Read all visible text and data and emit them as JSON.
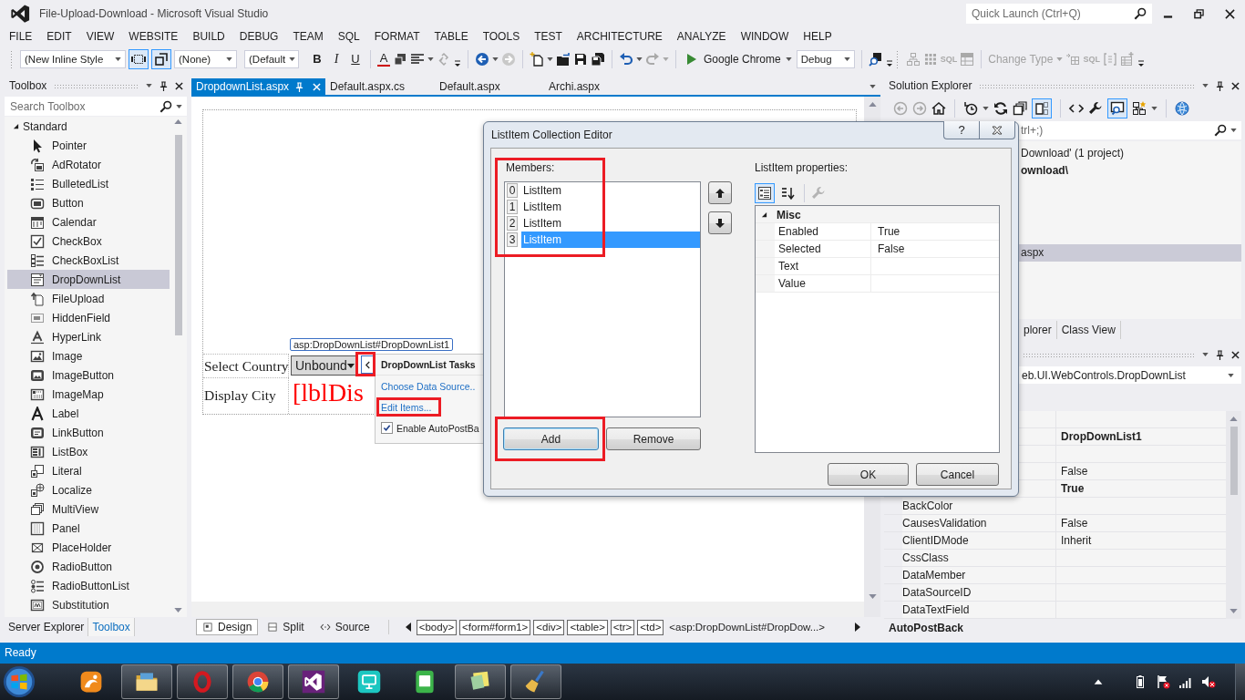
{
  "window": {
    "title": "File-Upload-Download - Microsoft Visual Studio",
    "quick_launch": {
      "placeholder": "Quick Launch (Ctrl+Q)"
    }
  },
  "menu": [
    "FILE",
    "EDIT",
    "VIEW",
    "WEBSITE",
    "BUILD",
    "DEBUG",
    "TEAM",
    "SQL",
    "FORMAT",
    "TABLE",
    "TOOLS",
    "TEST",
    "ARCHITECTURE",
    "ANALYZE",
    "WINDOW",
    "HELP"
  ],
  "toolbar": {
    "style_boxes": [
      "(New Inline Style",
      "(None)",
      "(Default"
    ],
    "layout_toggles": [
      {
        "on": true
      },
      {
        "on": true
      }
    ],
    "format_buttons": [
      {
        "kind": "bold",
        "label": "B"
      },
      {
        "kind": "italic",
        "label": "I"
      },
      {
        "kind": "underline",
        "label": "U"
      },
      {
        "kind": "color",
        "label": "A"
      }
    ],
    "run_button": "Google Chrome",
    "configuration": "Debug",
    "sql_buttons": [
      "SQL",
      "SQL"
    ],
    "change_type": {
      "label": "Change Type",
      "disabled": true
    }
  },
  "toolbox": {
    "title": "Toolbox",
    "search": {
      "placeholder": "Search Toolbox"
    },
    "groups": [
      {
        "label": "Standard",
        "expanded": true,
        "children": [
          {
            "label": "Pointer",
            "selected": false
          },
          {
            "label": "AdRotator",
            "selected": false
          },
          {
            "label": "BulletedList",
            "selected": false
          },
          {
            "label": "Button",
            "selected": false
          },
          {
            "label": "Calendar",
            "selected": false
          },
          {
            "label": "CheckBox",
            "selected": false
          },
          {
            "label": "CheckBoxList",
            "selected": false
          },
          {
            "label": "DropDownList",
            "selected": true
          },
          {
            "label": "FileUpload",
            "selected": false
          },
          {
            "label": "HiddenField",
            "selected": false
          },
          {
            "label": "HyperLink",
            "selected": false
          },
          {
            "label": "Image",
            "selected": false
          },
          {
            "label": "ImageButton",
            "selected": false
          },
          {
            "label": "ImageMap",
            "selected": false
          },
          {
            "label": "Label",
            "selected": false
          },
          {
            "label": "LinkButton",
            "selected": false
          },
          {
            "label": "ListBox",
            "selected": false
          },
          {
            "label": "Literal",
            "selected": false
          },
          {
            "label": "Localize",
            "selected": false
          },
          {
            "label": "MultiView",
            "selected": false
          },
          {
            "label": "Panel",
            "selected": false
          },
          {
            "label": "PlaceHolder",
            "selected": false
          },
          {
            "label": "RadioButton",
            "selected": false
          },
          {
            "label": "RadioButtonList",
            "selected": false
          },
          {
            "label": "Substitution",
            "selected": false
          }
        ]
      }
    ],
    "tabs": [
      {
        "label": "Server Explorer",
        "selected": false
      },
      {
        "label": "Toolbox",
        "selected": true
      }
    ]
  },
  "document_tabs": [
    {
      "label": "DropdownList.aspx",
      "selected": true
    },
    {
      "label": "Default.aspx.cs",
      "selected": false
    },
    {
      "label": "Default.aspx",
      "selected": false
    },
    {
      "label": "Archi.aspx",
      "selected": false
    }
  ],
  "designer": {
    "control_tag": "asp:DropDownList#DropDownList1",
    "rows": [
      {
        "kind": "dropdown",
        "label": "Select Country",
        "value": "Unbound"
      },
      {
        "kind": "label",
        "label": "Display City",
        "value": "[lblDis"
      }
    ],
    "smart_tag": {
      "highlighted": true
    },
    "tasks": {
      "title": "DropDownList Tasks",
      "items": [
        {
          "kind": "link",
          "label": "Choose Data Source..",
          "highlighted": false
        },
        {
          "kind": "link",
          "label": "Edit Items...",
          "highlighted": true
        },
        {
          "kind": "checkbox",
          "label": "Enable AutoPostBa",
          "checked": true
        }
      ]
    },
    "views": [
      {
        "label": "Design",
        "selected": true
      },
      {
        "label": "Split",
        "selected": false
      },
      {
        "label": "Source",
        "selected": false
      }
    ],
    "breadcrumb": [
      {
        "label": "<body>",
        "selected": false
      },
      {
        "label": "<form#form1>",
        "selected": false
      },
      {
        "label": "<div>",
        "selected": false
      },
      {
        "label": "<table>",
        "selected": false
      },
      {
        "label": "<tr>",
        "selected": false
      },
      {
        "label": "<td>",
        "selected": false
      },
      {
        "label": "<asp:DropDownList#DropDow...>",
        "selected": true
      }
    ]
  },
  "dialog": {
    "title": "ListItem Collection Editor",
    "help_button": "?",
    "members": {
      "label": "Members:",
      "highlighted": true,
      "items": [
        {
          "index": "0",
          "label": "ListItem",
          "selected": false
        },
        {
          "index": "1",
          "label": "ListItem",
          "selected": false
        },
        {
          "index": "2",
          "label": "ListItem",
          "selected": false
        },
        {
          "index": "3",
          "label": "ListItem",
          "selected": true
        }
      ]
    },
    "properties": {
      "label": "ListItem properties:",
      "sort_modes": [
        {
          "selected": true
        },
        {
          "selected": false
        }
      ],
      "category": {
        "label": "Misc",
        "expanded": true
      },
      "rows": [
        {
          "name": "Enabled",
          "value": "True"
        },
        {
          "name": "Selected",
          "value": "False"
        },
        {
          "name": "Text"
        },
        {
          "name": "Value"
        }
      ]
    },
    "list_buttons": [
      {
        "label": "Add",
        "highlighted": true,
        "focused": true
      },
      {
        "label": "Remove",
        "highlighted": false,
        "focused": false
      }
    ],
    "buttons": [
      "OK",
      "Cancel"
    ]
  },
  "solution_explorer": {
    "title": "Solution Explorer",
    "toolbar_toggles": [
      {
        "on": true
      },
      {
        "on": true
      }
    ],
    "search": {
      "placeholder": "trl+;)"
    },
    "items": [
      {
        "kind": "solution",
        "label": "Download' (1 project)",
        "selected": false
      },
      {
        "kind": "project",
        "label": "ownload\\",
        "selected": false
      },
      {
        "kind": "file",
        "label": "aspx",
        "selected": true
      }
    ],
    "tabs": [
      "plorer",
      "Class View"
    ]
  },
  "properties": {
    "object": "eb.UI.WebControls.DropDownList",
    "rows": [
      {
        "kind": "blank"
      },
      {
        "kind": "property",
        "value": "DropDownList1",
        "modified": true
      },
      {
        "kind": "blank"
      },
      {
        "kind": "property",
        "value": "False",
        "modified": false
      },
      {
        "kind": "property",
        "value": "True",
        "modified": true
      },
      {
        "kind": "property",
        "name": "BackColor"
      },
      {
        "kind": "property",
        "name": "CausesValidation",
        "value": "False",
        "modified": false
      },
      {
        "kind": "property",
        "name": "ClientIDMode",
        "value": "Inherit",
        "modified": false
      },
      {
        "kind": "property",
        "name": "CssClass"
      },
      {
        "kind": "property",
        "name": "DataMember"
      },
      {
        "kind": "property",
        "name": "DataSourceID"
      },
      {
        "kind": "property",
        "name": "DataTextField"
      }
    ],
    "description": "AutoPostBack"
  },
  "status_bar": "Ready",
  "taskbar": {
    "apps": [
      {
        "running": false
      },
      {
        "running": true
      },
      {
        "running": true
      },
      {
        "running": true
      },
      {
        "running": true
      },
      {
        "running": false
      },
      {
        "running": false
      },
      {
        "running": true
      },
      {
        "running": true
      }
    ]
  }
}
